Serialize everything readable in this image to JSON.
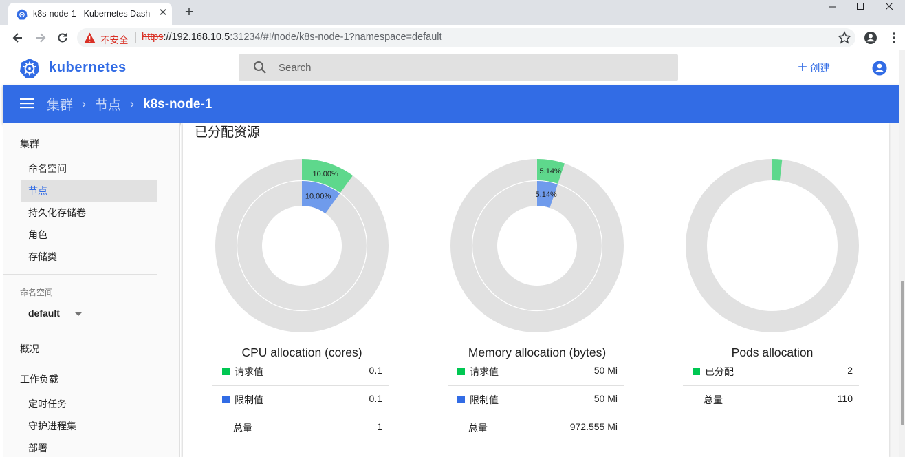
{
  "browser": {
    "tab_title": "k8s-node-1 - Kubernetes Dash",
    "insecure_label": "不安全",
    "url_scheme": "https",
    "url_host": "://192.168.10.5",
    "url_rest": ":31234/#!/node/k8s-node-1?namespace=default"
  },
  "header": {
    "brand": "kubernetes",
    "search_placeholder": "Search",
    "create_label": "创建"
  },
  "breadcrumb": {
    "items": [
      "集群",
      "节点",
      "k8s-node-1"
    ]
  },
  "sidebar": {
    "cluster_heading": "集群",
    "cluster_items": [
      "命名空间",
      "节点",
      "持久化存储卷",
      "角色",
      "存储类"
    ],
    "active_item": "节点",
    "namespace_label": "命名空间",
    "namespace_value": "default",
    "overview": "概况",
    "workloads_heading": "工作负载",
    "workload_items": [
      "定时任务",
      "守护进程集",
      "部署"
    ]
  },
  "card": {
    "title": "已分配资源"
  },
  "colors": {
    "accent": "#326ce5",
    "requests": "#00c752",
    "limits": "#326ce5",
    "ring_requests": "#5ed88c",
    "ring_limits": "#6f9bec",
    "ring_bg": "#e1e1e1"
  },
  "chart_data": [
    {
      "type": "pie",
      "title": "CPU allocation (cores)",
      "series": [
        {
          "name": "请求值",
          "fraction": 0.1,
          "label": "10.00%"
        },
        {
          "name": "限制值",
          "fraction": 0.1,
          "label": "10.00%"
        }
      ],
      "legend": [
        {
          "label": "请求值",
          "value": "0.1",
          "swatch": "requests"
        },
        {
          "label": "限制值",
          "value": "0.1",
          "swatch": "limits"
        },
        {
          "label": "总量",
          "value": "1",
          "swatch": ""
        }
      ]
    },
    {
      "type": "pie",
      "title": "Memory allocation (bytes)",
      "series": [
        {
          "name": "请求值",
          "fraction": 0.0514,
          "label": "5.14%"
        },
        {
          "name": "限制值",
          "fraction": 0.0514,
          "label": "5.14%"
        }
      ],
      "legend": [
        {
          "label": "请求值",
          "value": "50 Mi",
          "swatch": "requests"
        },
        {
          "label": "限制值",
          "value": "50 Mi",
          "swatch": "limits"
        },
        {
          "label": "总量",
          "value": "972.555 Mi",
          "swatch": ""
        }
      ]
    },
    {
      "type": "pie",
      "title": "Pods allocation",
      "series": [
        {
          "name": "已分配",
          "fraction": 0.0182,
          "label": ""
        }
      ],
      "legend": [
        {
          "label": "已分配",
          "value": "2",
          "swatch": "requests"
        },
        {
          "label": "总量",
          "value": "110",
          "swatch": ""
        }
      ]
    }
  ]
}
